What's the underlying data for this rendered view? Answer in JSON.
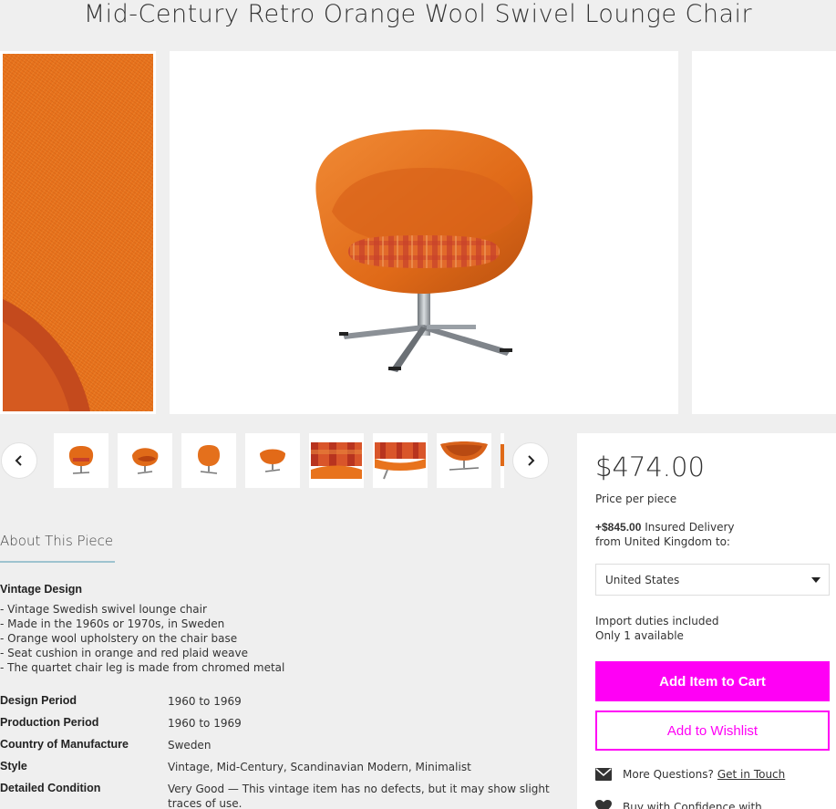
{
  "product": {
    "title": "Mid-Century Retro Orange Wool Swivel Lounge Chair"
  },
  "gallery": {
    "thumbnails": [
      {
        "icon": "chair-front"
      },
      {
        "icon": "chair-side"
      },
      {
        "icon": "chair-back"
      },
      {
        "icon": "chair-low"
      },
      {
        "icon": "plaid-cushion"
      },
      {
        "icon": "plaid-detail"
      },
      {
        "icon": "chair-top"
      },
      {
        "icon": "chair-partial"
      }
    ],
    "prev_icon": "chevron-left-icon",
    "next_icon": "chevron-right-icon"
  },
  "about": {
    "heading": "About This Piece",
    "vintage_title": "Vintage Design",
    "vintage_lines": [
      "- Vintage Swedish swivel lounge chair",
      "- Made in the 1960s or 1970s, in Sweden",
      "- Orange wool upholstery on the chair base",
      "- Seat cushion in orange and red plaid weave",
      "- The quartet chair leg is made from chromed metal"
    ],
    "specs": [
      {
        "label": "Design Period",
        "value": "1960 to 1969"
      },
      {
        "label": "Production Period",
        "value": "1960 to 1969"
      },
      {
        "label": "Country of Manufacture",
        "value": "Sweden"
      },
      {
        "label": "Style",
        "value": "Vintage, Mid-Century, Scandinavian Modern, Minimalist"
      },
      {
        "label": "Detailed Condition",
        "value": "Very Good — This vintage item has no defects, but it may show slight traces of use."
      }
    ]
  },
  "purchase": {
    "price": "$474.00",
    "price_note": "Price per piece",
    "delivery_price": "+$845.00",
    "delivery_text": " Insured Delivery",
    "delivery_from": "from United Kingdom to:",
    "country": "United States",
    "duties": "Import duties included",
    "availability": "Only 1 available",
    "add_to_cart": "Add Item to Cart",
    "add_to_wishlist": "Add to Wishlist",
    "questions_text": "More Questions?",
    "questions_link": "Get in Touch",
    "confidence_text": "Buy with Confidence with"
  },
  "colors": {
    "accent": "#ff00f5",
    "chair_orange": "#e8731d",
    "plaid_red": "#c8402a",
    "chrome": "#9aa0a6"
  }
}
